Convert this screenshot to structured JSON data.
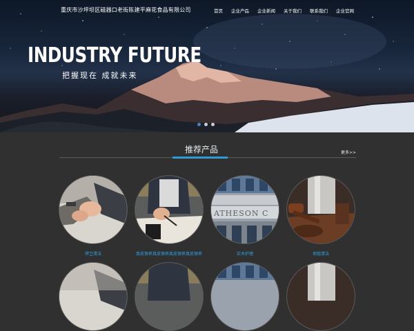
{
  "header": {
    "company_name": "重庆市沙坪坝区磁器口老街陈建平麻花食品有限公司",
    "nav": [
      "首页",
      "企业产品",
      "企业新闻",
      "关于我们",
      "联系我们",
      "企业官网"
    ]
  },
  "banner": {
    "headline": "INDUSTRY FUTURE",
    "slogan": "把握现在 成就未来",
    "slides": 3,
    "active_slide": 1
  },
  "section": {
    "title": "推荐产品",
    "more": "更多>>",
    "accent_color": "#2f9bd6"
  },
  "products": [
    {
      "label": "捍卫清洁",
      "image": "handshake"
    },
    {
      "label": "真皮保养真皮保养真皮保养真皮保养",
      "image": "signing-document"
    },
    {
      "label": "实木护理",
      "image": "building-facade"
    },
    {
      "label": "地毯清洁",
      "image": "gavel"
    }
  ],
  "colors": {
    "label_link": "#2fa1e6",
    "body_bg": "#303030"
  }
}
